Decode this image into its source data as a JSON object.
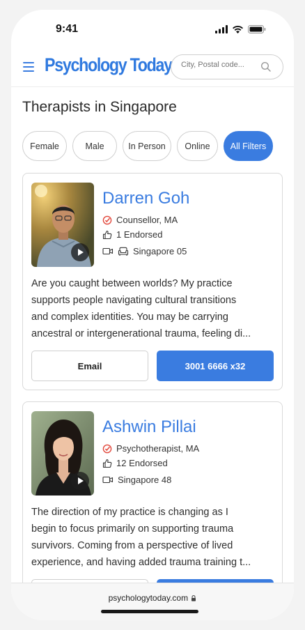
{
  "status_bar": {
    "time": "9:41"
  },
  "header": {
    "logo": "Psychology Today",
    "search_placeholder": "City, Postal code..."
  },
  "page_title": "Therapists in Singapore",
  "filters": [
    {
      "label": "Female",
      "active": false
    },
    {
      "label": "Male",
      "active": false
    },
    {
      "label": "In Person",
      "active": false
    },
    {
      "label": "Online",
      "active": false
    },
    {
      "label": "All Filters",
      "active": true
    }
  ],
  "therapists": [
    {
      "name": "Darren Goh",
      "credential": "Counsellor, MA",
      "endorsed": "1 Endorsed",
      "location": "Singapore 05",
      "description_lines": [
        "Are you caught between worlds? My practice",
        "supports people navigating cultural transitions",
        "and complex identities. You may be carrying",
        "ancestral or intergenerational trauma, feeling di..."
      ],
      "email_label": "Email",
      "phone_label": "3001 6666 x32"
    },
    {
      "name": "Ashwin Pillai",
      "credential": "Psychotherapist, MA",
      "endorsed": "12 Endorsed",
      "location": "Singapore 48",
      "description_lines": [
        "The direction of my practice is changing as I",
        "begin to focus primarily on supporting trauma",
        "survivors. Coming from a perspective of lived",
        "experience, and having added trauma training t..."
      ]
    }
  ],
  "browser": {
    "url": "psychologytoday.com"
  },
  "colors": {
    "accent": "#3a7ce0",
    "logo": "#2f79df",
    "verified": "#e2473b"
  }
}
